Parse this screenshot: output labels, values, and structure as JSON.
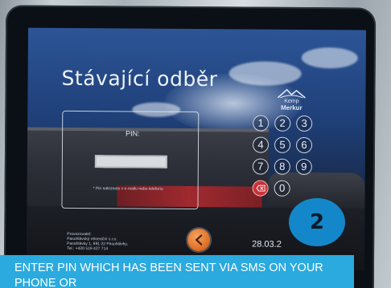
{
  "screen": {
    "title": "Stávající odběr",
    "logo": {
      "line1": "Kemp",
      "line2": "Merkur"
    },
    "pin": {
      "label": "PIN:",
      "value": "",
      "hint": "* Pin naleznete v e-mailu nebo telefonu"
    },
    "keypad": {
      "keys": [
        "1",
        "2",
        "3",
        "4",
        "5",
        "6",
        "7",
        "8",
        "9",
        "0"
      ],
      "delete_icon": "backspace-icon"
    },
    "back_icon": "chevron-left-icon",
    "operator": [
      "Provozovatel:",
      "Pasohlávský rekreační s.r.o.",
      "Pasohlávky 1, 691 22 Pasohlávky,",
      "Tel.: +420 519 427 714"
    ],
    "datetime": "28.03.2"
  },
  "step_badge": "2",
  "caption": "ENTER PIN WHICH HAS BEEN SENT VIA SMS ON YOUR PHONE OR",
  "colors": {
    "caption_bg": "#2aaadf",
    "badge_bg": "#1387c9",
    "back_button": "#e2722a",
    "delete_key": "#c8323a"
  }
}
